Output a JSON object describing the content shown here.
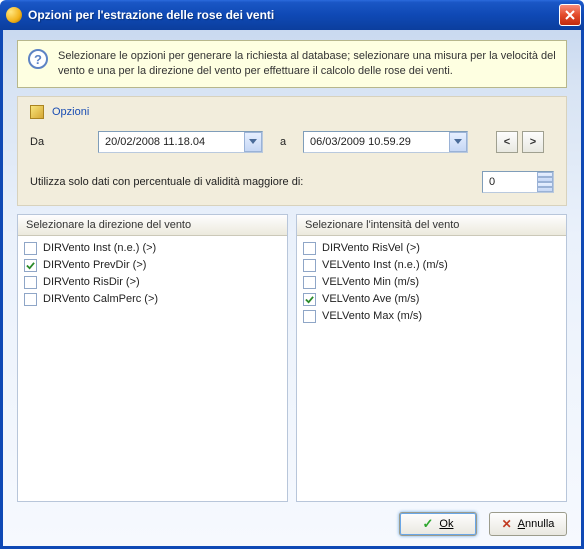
{
  "window": {
    "title": "Opzioni per l'estrazione delle rose dei venti"
  },
  "info": {
    "text": "Selezionare le opzioni per generare la richiesta al database; selezionare una misura per la velocità del vento e una per la direzione del vento per effettuare il calcolo delle rose dei venti."
  },
  "panel": {
    "title": "Opzioni",
    "from_label": "Da",
    "to_label": "a",
    "date_from": "20/02/2008 11.18.04",
    "date_to": "06/03/2009 10.59.29",
    "nav_prev": "<",
    "nav_next": ">",
    "validity_label": "Utilizza solo dati con percentuale di validità maggiore di:",
    "validity_value": "0"
  },
  "direction_list": {
    "header": "Selezionare la direzione del vento",
    "items": [
      {
        "label": "DIRVento Inst (n.e.) (>)",
        "checked": false
      },
      {
        "label": "DIRVento PrevDir (>)",
        "checked": true
      },
      {
        "label": "DIRVento RisDir (>)",
        "checked": false
      },
      {
        "label": "DIRVento CalmPerc (>)",
        "checked": false
      }
    ]
  },
  "intensity_list": {
    "header": "Selezionare l'intensità del vento",
    "items": [
      {
        "label": "DIRVento RisVel (>)",
        "checked": false
      },
      {
        "label": "VELVento Inst (n.e.) (m/s)",
        "checked": false
      },
      {
        "label": "VELVento Min (m/s)",
        "checked": false
      },
      {
        "label": "VELVento Ave (m/s)",
        "checked": true
      },
      {
        "label": "VELVento Max (m/s)",
        "checked": false
      }
    ]
  },
  "buttons": {
    "ok": "Ok",
    "cancel": "Annulla"
  }
}
